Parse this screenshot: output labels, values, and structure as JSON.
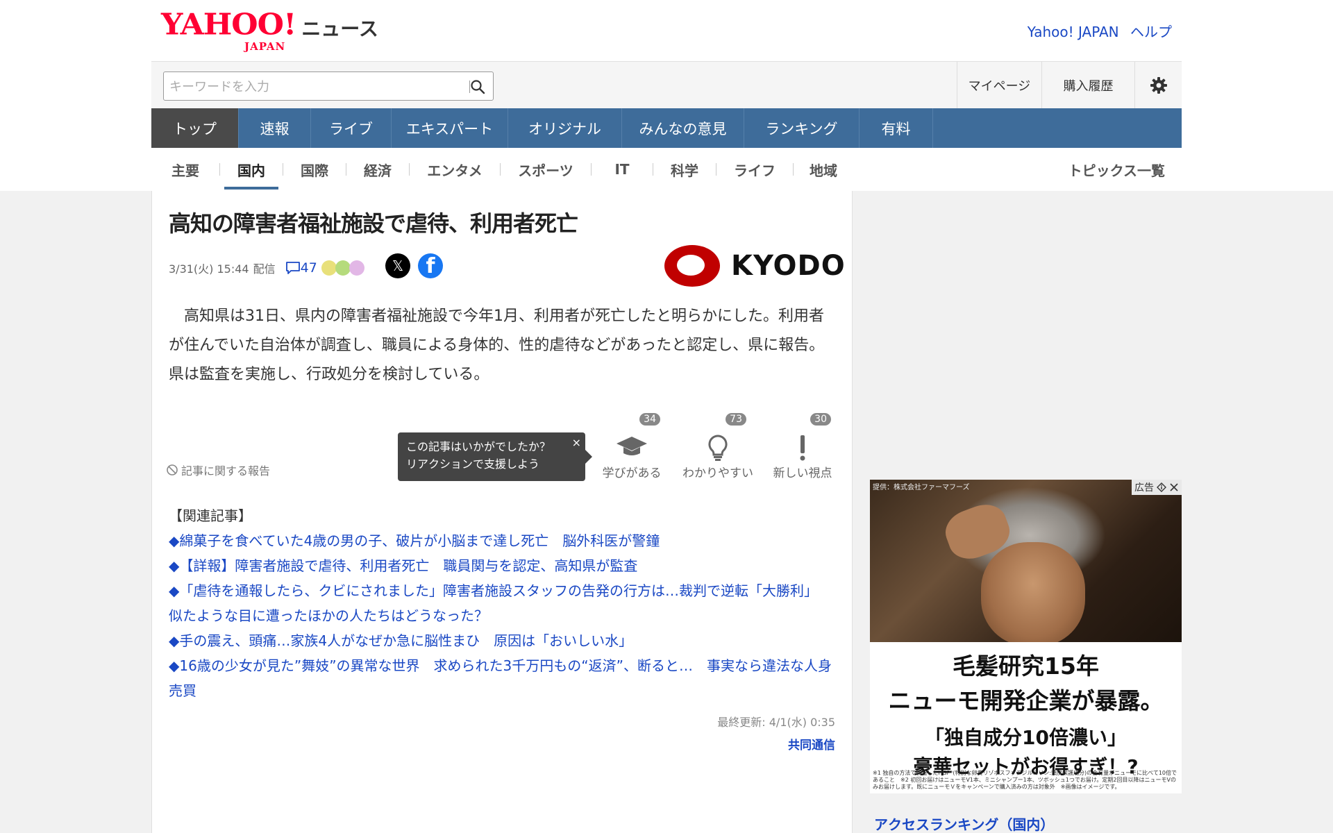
{
  "header": {
    "logo_text": "YAHOO!",
    "logo_sub": "JAPAN",
    "service_name": "ニュース",
    "links": [
      "Yahoo! JAPAN",
      "ヘルプ"
    ]
  },
  "search": {
    "placeholder": "キーワードを入力",
    "value": ""
  },
  "user_links": {
    "mypage": "マイページ",
    "history": "購入履歴",
    "settings_icon": "gear-icon"
  },
  "main_nav": [
    "トップ",
    "速報",
    "ライブ",
    "エキスパート",
    "オリジナル",
    "みんなの意見",
    "ランキング",
    "有料"
  ],
  "sub_nav": [
    "主要",
    "国内",
    "国際",
    "経済",
    "エンタメ",
    "スポーツ",
    "IT",
    "科学",
    "ライフ",
    "地域"
  ],
  "sub_nav_active": "国内",
  "topics_link": "トピックス一覧",
  "article": {
    "title": "高知の障害者福祉施設で虐待、利用者死亡",
    "date": "3/31(火) 15:44",
    "delivered": "配信",
    "comment_count": "47",
    "share_x": "𝕏",
    "share_fb": "f",
    "provider_logo": "KYODO",
    "body": "　高知県は31日、県内の障害者福祉施設で今年1月、利用者が死亡したと明らかにした。利用者が住んでいた自治体が調査し、職員による身体的、性的虐待などがあったと認定し、県に報告。県は監査を実施し、行政処分を検討している。",
    "report": "記事に関する報告",
    "tooltip_line1": "この記事はいかがでしたか？",
    "tooltip_line2": "リアクションで支援しよう",
    "tooltip_close": "×",
    "reactions": [
      {
        "label": "学びがある",
        "count": "34",
        "icon": "graduation-cap-icon"
      },
      {
        "label": "わかりやすい",
        "count": "73",
        "icon": "lightbulb-icon"
      },
      {
        "label": "新しい視点",
        "count": "30",
        "icon": "exclamation-icon"
      }
    ],
    "related_heading": "【関連記事】",
    "related": [
      "◆綿菓子を食べていた4歳の男の子、破片が小脳まで達し死亡　脳外科医が警鐘",
      "◆【詳報】障害者施設で虐待、利用者死亡　職員関与を認定、高知県が監査",
      "◆「虐待を通報したら、クビにされました」障害者施設スタッフの告発の行方は…裁判で逆転「大勝利」　似たような目に遭ったほかの人たちはどうなった？",
      "◆手の震え、頭痛…家族4人がなぜか急に脳性まひ　原因は「おいしい水」",
      "◆16歳の少女が見た”舞妓”の異常な世界　求められた3千万円もの“返済”、断ると…　事実なら違法な人身売買"
    ],
    "updated": "最終更新: 4/1(水) 0:35",
    "source": "共同通信"
  },
  "ad": {
    "provider": "提供：株式会社ファーマフーズ",
    "badge": "広告",
    "line1": "毛髪研究15年",
    "line2": "ニューモ開発企業が暴露。",
    "line3": "「独自成分10倍濃い」",
    "line4": "豪華セットがお得すぎ！?",
    "note": "※1 独自の方法で製造したHGP*(特別な卵黄リゾホスファチジルコリン:頭皮保護成分)の含有量がニューモに比べて10倍であること　※2 初回お届けはニューモV1本、ミニシャンプー1本、ツボッシュ1つでお届け。定期2回目以降はニューモVのみお届けします。既にニューモＶをキャンペーンで購入済みの方は対象外　※画像はイメージです。"
  },
  "sidebar": {
    "ranking_title": "アクセスランキング（国内）"
  },
  "colors": {
    "nav_bg": "#3e6c9a",
    "nav_active": "#4a4a4a",
    "link": "#1a48c4",
    "logo_red": "#ff0033"
  }
}
